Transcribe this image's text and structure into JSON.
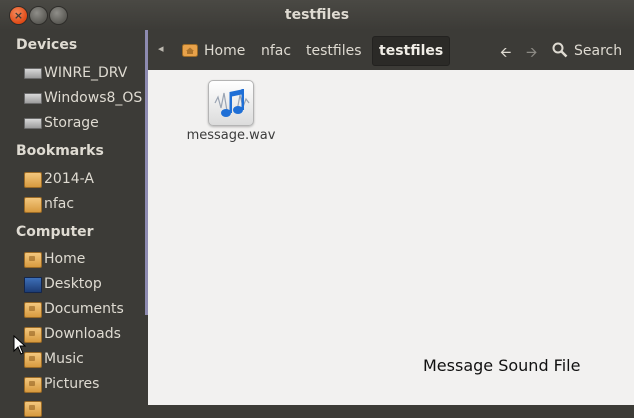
{
  "window": {
    "title": "testfiles"
  },
  "toolbar": {
    "breadcrumbs": [
      "Home",
      "nfac",
      "testfiles",
      "testfiles"
    ],
    "search_label": "Search"
  },
  "sidebar": {
    "devices_heading": "Devices",
    "devices": [
      "WINRE_DRV",
      "Windows8_OS",
      "Storage"
    ],
    "bookmarks_heading": "Bookmarks",
    "bookmarks": [
      "2014-A",
      "nfac"
    ],
    "computer_heading": "Computer",
    "computer": [
      "Home",
      "Desktop",
      "Documents",
      "Downloads",
      "Music",
      "Pictures"
    ]
  },
  "files": [
    {
      "name": "message.wav",
      "icon": "audio-file-icon"
    }
  ],
  "caption": "Message Sound File",
  "colors": {
    "accent_scrollbar": "#8e8bb1",
    "close_button": "#df4a16"
  }
}
